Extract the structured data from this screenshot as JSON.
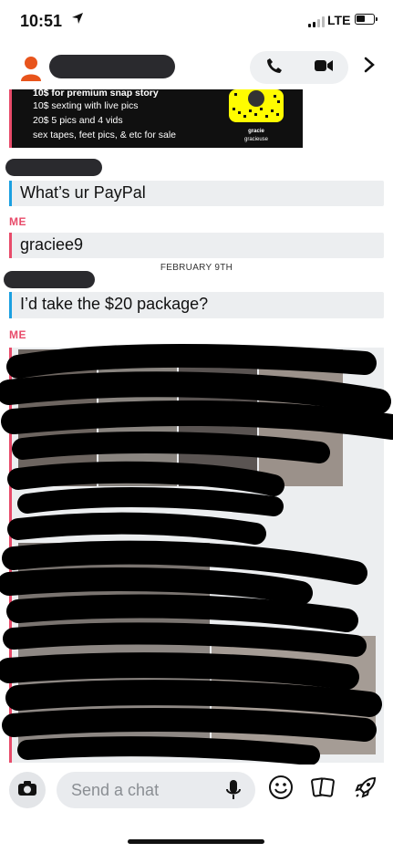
{
  "status": {
    "time": "10:51",
    "network": "LTE"
  },
  "header": {
    "back_icon": "chevron-right-icon"
  },
  "snap_card": {
    "lines": [
      "10$ for premium snap story",
      "10$ sexting with live pics",
      "20$ 5 pics and 4 vids",
      "sex tapes, feet pics, & etc for sale"
    ],
    "code_name": "gracie",
    "code_handle": "gracieuse"
  },
  "messages": [
    {
      "sender_label": "",
      "text": "What’s ur PayPal",
      "color": "#1ba0e1"
    },
    {
      "sender_label": "ME",
      "text": "graciee9",
      "color": "#e84b6a"
    }
  ],
  "date_separator": "FEBRUARY 9TH",
  "messages2": [
    {
      "sender_label": "",
      "text": "I’d take the $20 package?",
      "color": "#1ba0e1"
    }
  ],
  "me_label_2": "ME",
  "composer": {
    "placeholder": "Send a chat"
  },
  "colors": {
    "me": "#e84b6a",
    "them": "#1ba0e1",
    "snap_yellow": "#fffc00"
  }
}
